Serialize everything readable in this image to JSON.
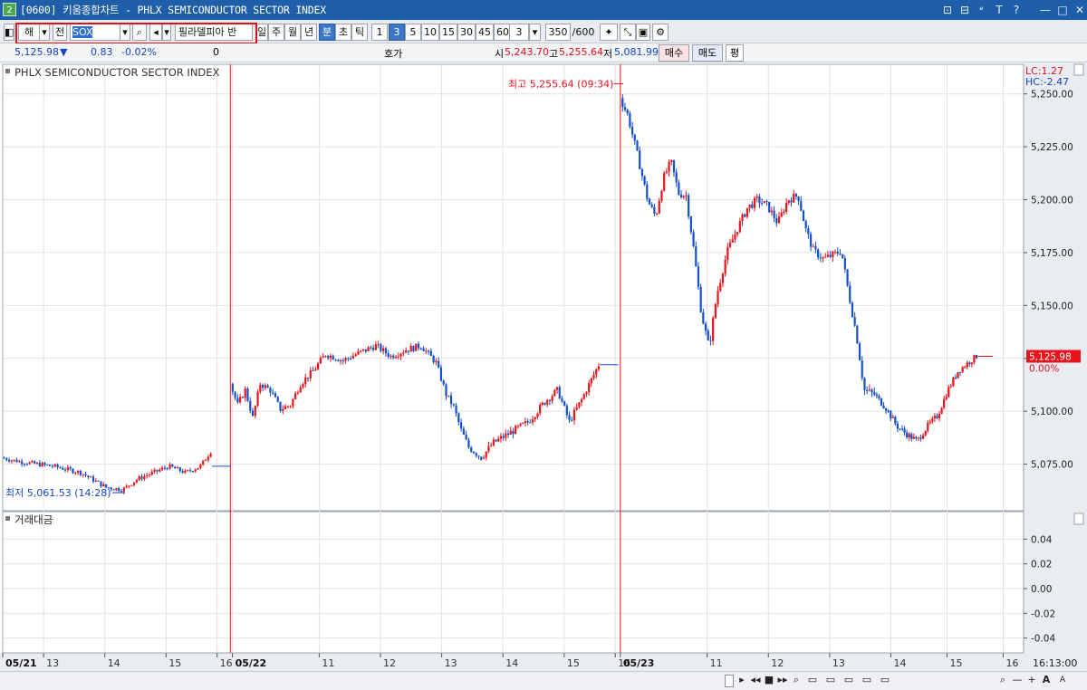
{
  "window": {
    "title": "[0600] 키움종합차트 - PHLX SEMICONDUCTOR SECTOR INDEX",
    "app_icon_label": "2",
    "controls": [
      "⊡",
      "⊟",
      "ʶ",
      "T",
      "?",
      "—",
      "□",
      "✕"
    ]
  },
  "toolbar": {
    "market_selector": "해",
    "prefix_label": "전",
    "symbol_value": "SOX",
    "search_icon": "search-icon",
    "sound_icon": "speaker-icon",
    "symbol_name": "필라델피아 반",
    "period_buttons": [
      "일",
      "주",
      "월",
      "년",
      "분",
      "초",
      "틱"
    ],
    "active_period": "분",
    "interval_buttons": [
      "1",
      "3",
      "5",
      "10",
      "15",
      "30",
      "45",
      "60"
    ],
    "active_interval": "3",
    "interval_select": "3",
    "count_value": "350",
    "count_max": "/600",
    "tool_icons": [
      "cursor-tool-icon",
      "line-tool-icon",
      "save-icon",
      "settings-icon"
    ]
  },
  "infobar": {
    "price": "5,125.98",
    "direction": "▼",
    "change": "0.83",
    "change_pct": "-0.02%",
    "volume": "0",
    "quote_label": "호가",
    "open_label": "시",
    "open_value": "5,243.70",
    "high_label": "고",
    "high_value": "5,255.64",
    "low_label": "저",
    "low_value": "5,081.99",
    "buy_label": "매수",
    "sell_label": "매도",
    "eval_label": "평"
  },
  "statusbar": {
    "buttons": [
      "▸",
      "◂◂",
      "■",
      "▸▸",
      "⌕",
      "▭",
      "▭",
      "▭",
      "▭",
      "▭",
      "⌕",
      "—",
      "+",
      "A",
      "A"
    ]
  },
  "chart_data": {
    "type": "candlestick",
    "title": "PHLX SEMICONDUCTOR SECTOR INDEX",
    "subtitle_lower": "거래대금",
    "lc_label": "LC:1.27",
    "hc_label": "HC:-2.47",
    "y_ticks": [
      "5,250.00",
      "5,225.00",
      "5,200.00",
      "5,175.00",
      "5,150.00",
      "5,125.00",
      "5,100.00",
      "5,075.00"
    ],
    "y_tick_values": [
      5250,
      5225,
      5200,
      5175,
      5150,
      5125,
      5100,
      5075
    ],
    "ylim": [
      5053,
      5258
    ],
    "lower_ticks": [
      "0.04",
      "0.02",
      "0.00",
      "-0.02",
      "-0.04"
    ],
    "lower_tick_values": [
      0.04,
      0.02,
      0.0,
      -0.02,
      -0.04
    ],
    "lower_ylim": [
      -0.052,
      0.052
    ],
    "last_price_label": "5,125.98",
    "last_pct_label": "0.00%",
    "last_price": 5125.98,
    "high_annotation": "최고 5,255.64 (09:34)",
    "high_value": 5255.64,
    "low_annotation": "최저 5,061.53 (14:28)",
    "low_value": 5061.53,
    "x_labels": [
      "05/21",
      "13",
      "14",
      "15",
      "16",
      "05/22",
      "11",
      "12",
      "13",
      "14",
      "15",
      "16",
      "05/23",
      "11",
      "12",
      "13",
      "14",
      "15",
      "16"
    ],
    "x_label_fracs": [
      0.0,
      0.04,
      0.1,
      0.16,
      0.21,
      0.225,
      0.31,
      0.37,
      0.43,
      0.49,
      0.55,
      0.6,
      0.605,
      0.69,
      0.75,
      0.81,
      0.87,
      0.925,
      0.98
    ],
    "x_time_label": "16:13:00",
    "session_breaks_frac": [
      0.223,
      0.605
    ],
    "days": [
      {
        "name": "05/21",
        "path": [
          [
            0,
            5078
          ],
          [
            0.1,
            5076
          ],
          [
            0.25,
            5074
          ],
          [
            0.38,
            5071
          ],
          [
            0.5,
            5064
          ],
          [
            0.58,
            5063
          ],
          [
            0.65,
            5068
          ],
          [
            0.8,
            5074
          ],
          [
            0.88,
            5071
          ],
          [
            0.95,
            5074
          ],
          [
            1.0,
            5081
          ]
        ],
        "end_flat": 5074
      },
      {
        "name": "05/22",
        "path": [
          [
            0,
            5113
          ],
          [
            0.03,
            5103
          ],
          [
            0.06,
            5110
          ],
          [
            0.09,
            5097
          ],
          [
            0.12,
            5113
          ],
          [
            0.16,
            5110
          ],
          [
            0.2,
            5101
          ],
          [
            0.24,
            5103
          ],
          [
            0.28,
            5113
          ],
          [
            0.33,
            5119
          ],
          [
            0.38,
            5127
          ],
          [
            0.45,
            5124
          ],
          [
            0.52,
            5128
          ],
          [
            0.58,
            5131
          ],
          [
            0.64,
            5126
          ],
          [
            0.7,
            5129
          ],
          [
            0.76,
            5131
          ],
          [
            0.82,
            5123
          ],
          [
            0.86,
            5108
          ],
          [
            0.89,
            5102
          ],
          [
            0.92,
            5091
          ],
          [
            0.95,
            5083
          ],
          [
            0.98,
            5080
          ],
          [
            1.0,
            5078
          ]
        ],
        "end_flat": 5122
      },
      {
        "name": "05/22b",
        "path": [
          [
            0,
            5078
          ],
          [
            0.1,
            5085
          ],
          [
            0.25,
            5090
          ],
          [
            0.4,
            5095
          ],
          [
            0.55,
            5105
          ],
          [
            0.65,
            5110
          ],
          [
            0.75,
            5095
          ],
          [
            0.85,
            5105
          ],
          [
            1.0,
            5122
          ]
        ]
      },
      {
        "name": "05/23",
        "path": [
          [
            0,
            5248
          ],
          [
            0.03,
            5240
          ],
          [
            0.07,
            5220
          ],
          [
            0.11,
            5199
          ],
          [
            0.14,
            5192
          ],
          [
            0.17,
            5210
          ],
          [
            0.2,
            5218
          ],
          [
            0.23,
            5203
          ],
          [
            0.26,
            5202
          ],
          [
            0.29,
            5176
          ],
          [
            0.32,
            5146
          ],
          [
            0.35,
            5130
          ],
          [
            0.38,
            5155
          ],
          [
            0.42,
            5175
          ],
          [
            0.46,
            5186
          ],
          [
            0.5,
            5196
          ],
          [
            0.54,
            5200
          ],
          [
            0.58,
            5197
          ],
          [
            0.62,
            5189
          ],
          [
            0.66,
            5200
          ],
          [
            0.7,
            5202
          ],
          [
            0.73,
            5186
          ],
          [
            0.76,
            5176
          ],
          [
            0.8,
            5172
          ],
          [
            0.84,
            5174
          ],
          [
            0.87,
            5176
          ],
          [
            0.9,
            5155
          ],
          [
            0.93,
            5136
          ],
          [
            0.96,
            5110
          ],
          [
            1.0,
            5108
          ]
        ]
      },
      {
        "name": "05/23b",
        "path": [
          [
            0,
            5108
          ],
          [
            0.12,
            5101
          ],
          [
            0.22,
            5093
          ],
          [
            0.32,
            5089
          ],
          [
            0.42,
            5086
          ],
          [
            0.52,
            5093
          ],
          [
            0.62,
            5098
          ],
          [
            0.72,
            5110
          ],
          [
            0.82,
            5119
          ],
          [
            0.92,
            5123
          ],
          [
            1.0,
            5126
          ]
        ]
      }
    ],
    "colors": {
      "up": "#e8141c",
      "down": "#1450c8",
      "grid": "#e2e2e2",
      "axis_bg": "#e9ecf0",
      "high_text": "#e8141c",
      "low_text": "#1844c8"
    }
  }
}
